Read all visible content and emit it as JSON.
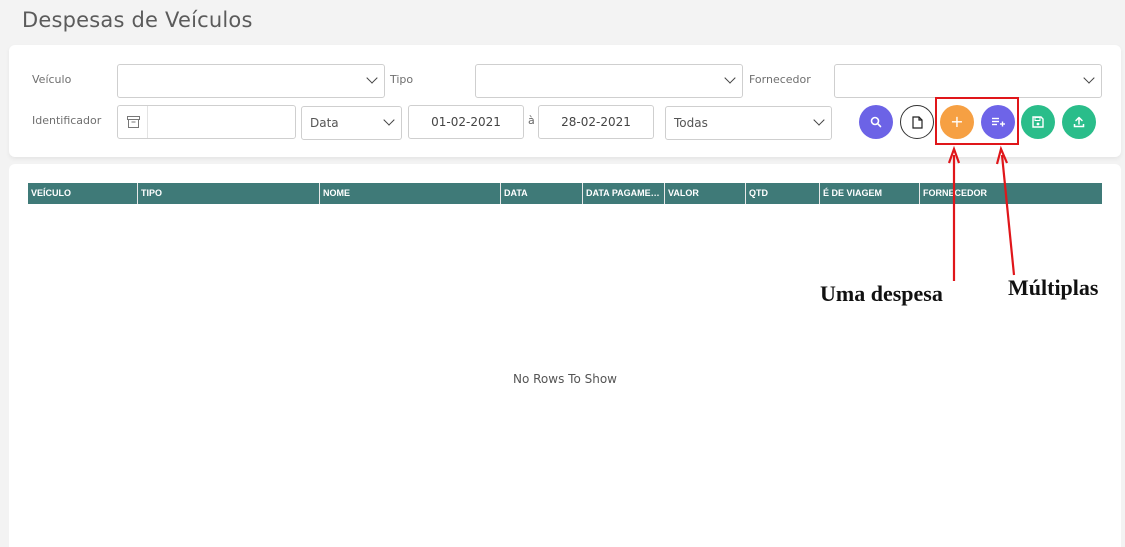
{
  "page_title": "Despesas de Veículos",
  "filters": {
    "veiculo_label": "Veículo",
    "tipo_label": "Tipo",
    "fornecedor_label": "Fornecedor",
    "identificador_label": "Identificador",
    "date_type_value": "Data",
    "date_from": "01-02-2021",
    "date_separator": "à",
    "date_to": "28-02-2021",
    "status_value": "Todas"
  },
  "actions": {
    "search_icon": "search-icon",
    "new_doc_icon": "document-icon",
    "add_label": "+",
    "multi_icon": "playlist-add-icon",
    "save_icon": "save-icon",
    "upload_icon": "upload-icon",
    "highlight_color": "#e0161a"
  },
  "grid": {
    "columns": [
      "VEÍCULO",
      "TIPO",
      "NOME",
      "DATA",
      "DATA PAGAMENTO",
      "VALOR",
      "QTD",
      "É DE VIAGEM",
      "FORNECEDOR"
    ],
    "empty_message": "No Rows To Show",
    "header_color": "#3f7a78"
  },
  "annotations": {
    "single": "Uma despesa",
    "multiple": "Múltiplas"
  }
}
